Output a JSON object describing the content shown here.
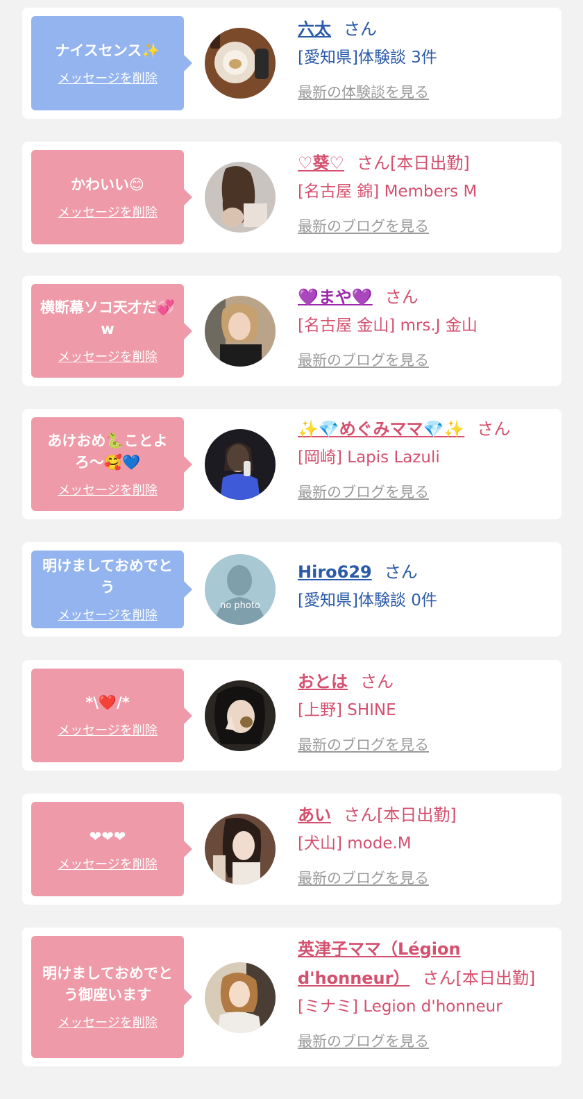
{
  "colors": {
    "card_bg": "#ffffff",
    "page_bg": "#f2f2f2",
    "bubble_blue": "#93b4ee",
    "bubble_pink": "#ee9aa8",
    "text_blue": "#2a5aa8",
    "text_pink": "#d4506e",
    "link_gray": "#9b9b9b"
  },
  "cards": [
    {
      "message": "ナイスセンス✨",
      "delete_label": "メッセージを削除",
      "name": "六太",
      "san": "さん",
      "shop": "[愛知県]体験談 3件",
      "link": "最新の体験談を見る"
    },
    {
      "message": "かわいい😊",
      "delete_label": "メッセージを削除",
      "name": "♡葵♡",
      "san": "さん[本日出勤]",
      "shop": "[名古屋 錦] Members M",
      "link": "最新のブログを見る"
    },
    {
      "message": "横断幕ソコ天才だ💞w",
      "delete_label": "メッセージを削除",
      "name": "💜まや💜",
      "san": "さん",
      "shop": "[名古屋 金山] mrs.J 金山",
      "link": "最新のブログを見る"
    },
    {
      "message": "あけおめ🐍ことよろ〜🥰💙",
      "delete_label": "メッセージを削除",
      "name": "✨💎めぐみママ💎✨",
      "san": "さん",
      "shop": "[岡崎] Lapis Lazuli",
      "link": "最新のブログを見る"
    },
    {
      "message": "明けましておめでとう",
      "delete_label": "メッセージを削除",
      "name": "Hiro629",
      "san": "さん",
      "shop": "[愛知県]体験談 0件",
      "avatar_text": "no photo"
    },
    {
      "message": "*\\❤️/*",
      "delete_label": "メッセージを削除",
      "name": "おとは",
      "san": "さん",
      "shop": "[上野] SHINE",
      "link": "最新のブログを見る"
    },
    {
      "message": "❤❤❤",
      "delete_label": "メッセージを削除",
      "name": "あい",
      "san": "さん[本日出勤]",
      "shop": "[犬山] mode.M",
      "link": "最新のブログを見る"
    },
    {
      "message": "明けましておめでとう御座います",
      "delete_label": "メッセージを削除",
      "name": "英津子ママ（Légion d'honneur）",
      "san": "さん[本日出勤]",
      "shop": "[ミナミ] Legion d'honneur",
      "link": "最新のブログを見る"
    }
  ]
}
